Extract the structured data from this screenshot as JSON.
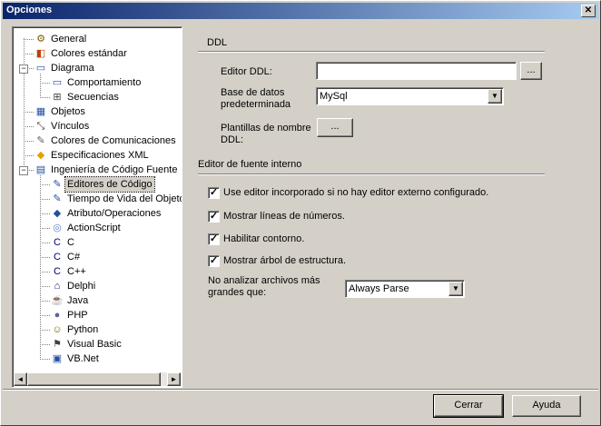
{
  "window": {
    "title": "Opciones",
    "close_glyph": "✕"
  },
  "tree": {
    "items": [
      {
        "label": "General",
        "icon": "general-icon",
        "glyph": "⚙",
        "color": "#806000"
      },
      {
        "label": "Colores estándar",
        "icon": "colors-icon",
        "glyph": "◧",
        "color": "#c04000"
      },
      {
        "label": "Diagrama",
        "icon": "diagram-icon",
        "glyph": "▭",
        "color": "#2050a0"
      },
      {
        "label": "Comportamiento",
        "icon": "behavior-icon",
        "glyph": "▭",
        "color": "#2050a0"
      },
      {
        "label": "Secuencias",
        "icon": "sequence-icon",
        "glyph": "⊞",
        "color": "#404040"
      },
      {
        "label": "Objetos",
        "icon": "objects-icon",
        "glyph": "▦",
        "color": "#2050a0"
      },
      {
        "label": "Vínculos",
        "icon": "links-icon",
        "glyph": "⤡",
        "color": "#404040"
      },
      {
        "label": "Colores de Comunicaciones",
        "icon": "comm-colors-icon",
        "glyph": "✎",
        "color": "#606060"
      },
      {
        "label": "Especificaciones XML",
        "icon": "xml-icon",
        "glyph": "◆",
        "color": "#e0a000"
      },
      {
        "label": "Ingeniería de Código Fuente",
        "icon": "source-engineering-icon",
        "glyph": "▤",
        "color": "#2050a0"
      },
      {
        "label": "Editores de Código",
        "icon": "code-editor-icon",
        "glyph": "✎",
        "color": "#2050a0"
      },
      {
        "label": "Tiempo de Vida del Objeto",
        "icon": "object-lifetime-icon",
        "glyph": "✎",
        "color": "#2050a0"
      },
      {
        "label": "Atributo/Operaciones",
        "icon": "attributes-icon",
        "glyph": "◆",
        "color": "#2050a0"
      },
      {
        "label": "ActionScript",
        "icon": "actionscript-icon",
        "glyph": "◎",
        "color": "#6080c0"
      },
      {
        "label": "C",
        "icon": "c-icon",
        "glyph": "C",
        "color": "#000080"
      },
      {
        "label": "C#",
        "icon": "csharp-icon",
        "glyph": "C",
        "color": "#000080"
      },
      {
        "label": "C++",
        "icon": "cpp-icon",
        "glyph": "C",
        "color": "#000080"
      },
      {
        "label": "Delphi",
        "icon": "delphi-icon",
        "glyph": "⌂",
        "color": "#000080"
      },
      {
        "label": "Java",
        "icon": "java-icon",
        "glyph": "☕",
        "color": "#2050a0"
      },
      {
        "label": "PHP",
        "icon": "php-icon",
        "glyph": "●",
        "color": "#6060a0"
      },
      {
        "label": "Python",
        "icon": "python-icon",
        "glyph": "☺",
        "color": "#806000"
      },
      {
        "label": "Visual Basic",
        "icon": "vb-icon",
        "glyph": "⚑",
        "color": "#404040"
      },
      {
        "label": "VB.Net",
        "icon": "vbnet-icon",
        "glyph": "▣",
        "color": "#2050a0"
      }
    ],
    "scroll_left": "◄",
    "scroll_right": "►",
    "expand_glyph": "−"
  },
  "ddl": {
    "section_title": "DDL",
    "editor_label": "Editor DDL:",
    "editor_value": "",
    "browse_label": "...",
    "database_label_1": "Base de datos",
    "database_label_2": "predeterminada",
    "database_value": "MySql",
    "templates_label_1": "Plantillas de nombre",
    "templates_label_2": "DDL:",
    "templates_button": "..."
  },
  "editor": {
    "section_title": "Editor de fuente interno",
    "options": [
      {
        "label": "Use editor incorporado si no hay editor externo configurado.",
        "checked": true
      },
      {
        "label": "Mostrar líneas de números.",
        "checked": true
      },
      {
        "label": "Habilitar contorno.",
        "checked": true
      },
      {
        "label": "Mostrar árbol de estructura.",
        "checked": true
      }
    ],
    "no_parse_label_1": "No analizar archivos más",
    "no_parse_label_2": "grandes que:",
    "no_parse_value": "Always Parse",
    "check_glyph": "✓",
    "dropdown_glyph": "▼"
  },
  "buttons": {
    "close": "Cerrar",
    "help": "Ayuda"
  }
}
